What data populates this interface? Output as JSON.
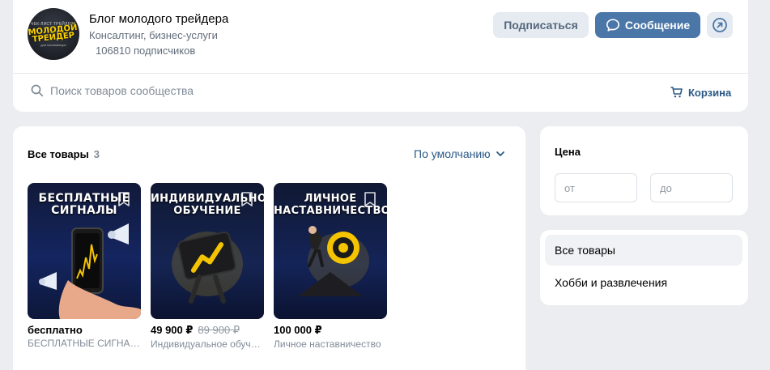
{
  "group": {
    "title": "Блог молодого трейдера",
    "category": "Консалтинг, бизнес-услуги",
    "subscribers": "106810 подписчиков",
    "avatar": {
      "top": "ЧЕК-ЛИСТ ТРЕЙДЕРА",
      "main_line1": "МОЛОДОЙ",
      "main_line2": "ТРЕЙДЕР",
      "bottom": "для начинающих"
    }
  },
  "actions": {
    "subscribe_label": "Подписаться",
    "message_label": "Сообщение",
    "share_icon": "share-arrow-icon"
  },
  "search": {
    "placeholder": "Поиск товаров сообщества",
    "cart_label": "Корзина"
  },
  "products": {
    "heading": "Все товары",
    "count": "3",
    "sort_label": "По умолчанию",
    "items": [
      {
        "thumb_title_1": "БЕСПЛАТНЫЕ",
        "thumb_title_2": "СИГНАЛЫ",
        "price": "бесплатно",
        "old_price": "",
        "name": "БЕСПЛАТНЫЕ СИГНАЛЫ"
      },
      {
        "thumb_title_1": "ИНДИВИДУАЛЬНОЕ",
        "thumb_title_2": "ОБУЧЕНИЕ",
        "price": "49 900 ₽",
        "old_price": "89 900 ₽",
        "name": "Индивидуальное обучение"
      },
      {
        "thumb_title_1": "ЛИЧНОЕ",
        "thumb_title_2": "НАСТАВНИЧЕСТВО",
        "price": "100 000 ₽",
        "old_price": "",
        "name": "Личное наставничество"
      }
    ]
  },
  "price_filter": {
    "label": "Цена",
    "from_placeholder": "от",
    "to_placeholder": "до"
  },
  "categories": [
    {
      "label": "Все товары",
      "active": true
    },
    {
      "label": "Хобби и развлечения",
      "active": false
    }
  ],
  "colors": {
    "accent": "#4a76a8",
    "link": "#2a5885",
    "background": "#ebedf0"
  }
}
